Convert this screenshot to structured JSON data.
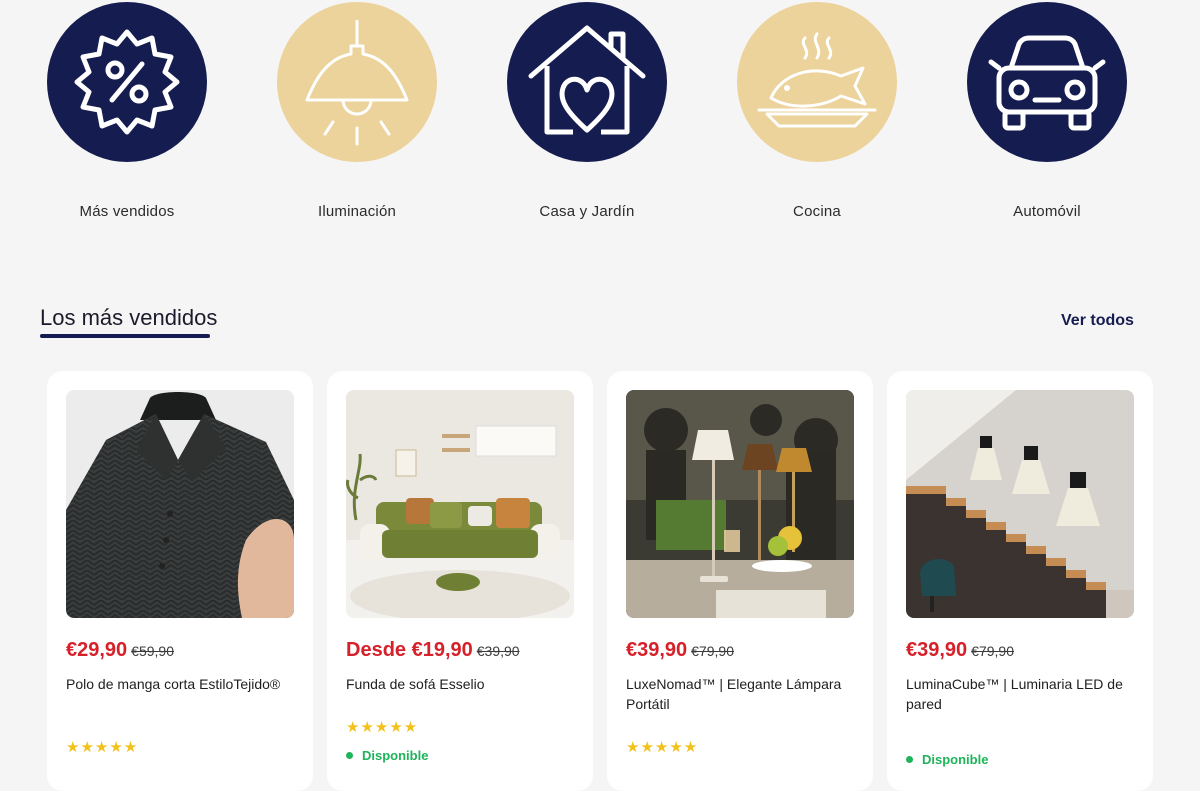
{
  "categories": [
    {
      "label": "Más vendidos",
      "icon": "discount-badge-icon",
      "color": "#151c4f"
    },
    {
      "label": "Iluminación",
      "icon": "ceiling-lamp-icon",
      "color": "#ecd29b"
    },
    {
      "label": "Casa y Jardín",
      "icon": "house-heart-icon",
      "color": "#151c4f"
    },
    {
      "label": "Cocina",
      "icon": "cooked-fish-icon",
      "color": "#ecd29b"
    },
    {
      "label": "Automóvil",
      "icon": "car-icon",
      "color": "#151c4f"
    }
  ],
  "section": {
    "title": "Los más vendidos",
    "view_all": "Ver todos"
  },
  "products": [
    {
      "price": "€29,90",
      "old_price": "€59,90",
      "name": "Polo de manga corta EstiloTejido®",
      "stars": "★★★★★",
      "rating": 5,
      "image": "dark-knit-polo-shirt"
    },
    {
      "price": "Desde €19,90",
      "old_price": "€39,90",
      "name": "Funda de sofá Esselio",
      "stars": "★★★★★",
      "rating": 5,
      "availability": "Disponible",
      "image": "green-sofa-living-room"
    },
    {
      "price": "€39,90",
      "old_price": "€79,90",
      "name": "LuxeNomad™ | Elegante Lámpara Portátil",
      "stars": "★★★★★",
      "rating": 5,
      "image": "table-lamps-restaurant"
    },
    {
      "price": "€39,90",
      "old_price": "€79,90",
      "name": "LuminaCube™ | Luminaria LED de pared",
      "availability": "Disponible",
      "image": "wall-lights-staircase"
    }
  ],
  "colors": {
    "navy": "#151c4f",
    "gold": "#ecd29b",
    "sale_red": "#d6202a",
    "star_yellow": "#f2c11a",
    "available_green": "#1fb35a"
  }
}
